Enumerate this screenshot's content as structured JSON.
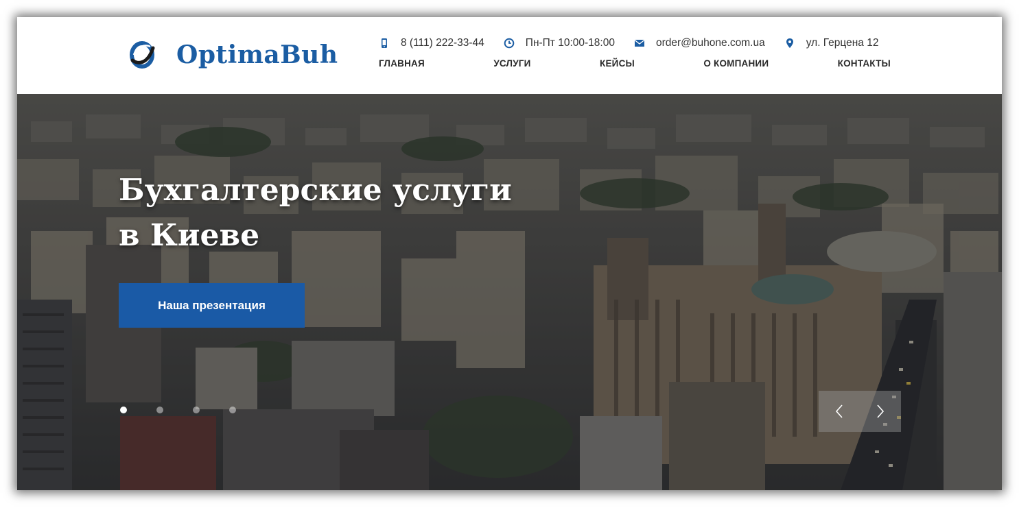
{
  "brand": {
    "name": "OptimaBuh",
    "accent_color": "#1b5da3",
    "logo_icon": "ring-logo-icon"
  },
  "contacts": {
    "phone": {
      "icon": "phone-icon",
      "text": "8 (111) 222-33-44"
    },
    "hours": {
      "icon": "clock-icon",
      "text": "Пн-Пт 10:00-18:00"
    },
    "email": {
      "icon": "envelope-icon",
      "text": "order@buhone.com.ua"
    },
    "address": {
      "icon": "map-pin-icon",
      "text": "ул. Герцена 12"
    }
  },
  "nav": {
    "items": [
      {
        "label": "ГЛАВНАЯ"
      },
      {
        "label": "УСЛУГИ"
      },
      {
        "label": "КЕЙСЫ"
      },
      {
        "label": "О КОМПАНИИ"
      },
      {
        "label": "КОНТАКТЫ"
      }
    ]
  },
  "hero": {
    "title_line1": "Бухгалтерские услуги",
    "title_line2": "в Киеве",
    "cta_label": "Наша презентация",
    "cta_color": "#1a5aa6",
    "slides_total": 4,
    "active_slide": 1,
    "prev_icon": "chevron-left-icon",
    "next_icon": "chevron-right-icon"
  }
}
